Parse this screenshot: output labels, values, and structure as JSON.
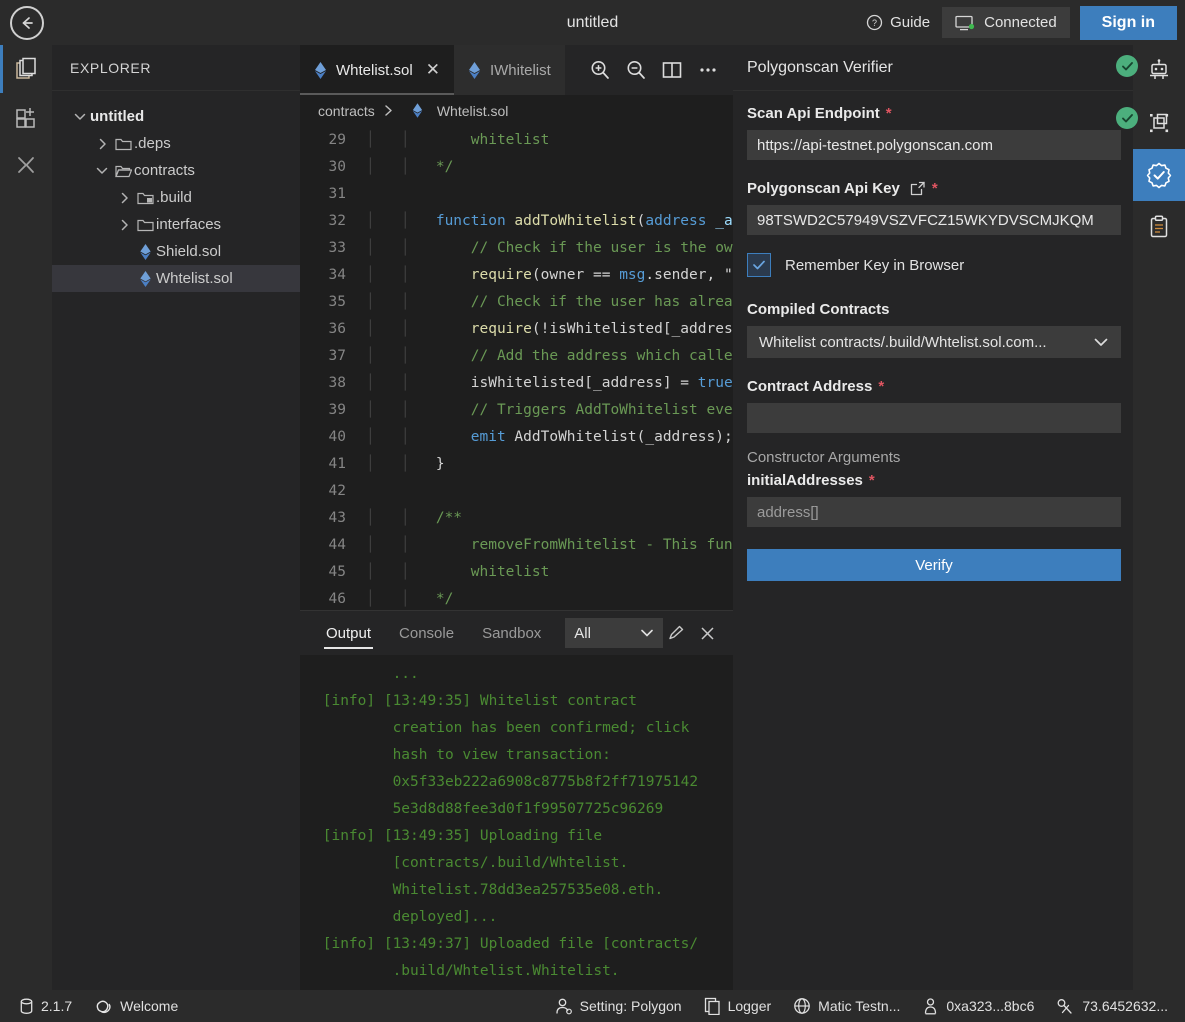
{
  "titlebar": {
    "title": "untitled",
    "guide_label": "Guide",
    "connected_label": "Connected",
    "signin_label": "Sign in"
  },
  "activitybar": {
    "items": [
      {
        "name": "file-explorer-icon",
        "label": "Files"
      },
      {
        "name": "plugin-manager-icon",
        "label": "Plugin Manager"
      },
      {
        "name": "collapse-icon",
        "label": "Collapse"
      }
    ]
  },
  "explorer": {
    "header": "EXPLORER",
    "tree": [
      {
        "label": "untitled",
        "depth": 0,
        "type": "root",
        "expanded": true,
        "selected": false
      },
      {
        "label": ".deps",
        "depth": 1,
        "type": "folder",
        "expanded": false,
        "selected": false
      },
      {
        "label": "contracts",
        "depth": 1,
        "type": "folder",
        "expanded": true,
        "selected": false
      },
      {
        "label": ".build",
        "depth": 2,
        "type": "folder-build",
        "expanded": false,
        "selected": false
      },
      {
        "label": "interfaces",
        "depth": 2,
        "type": "folder",
        "expanded": false,
        "selected": false
      },
      {
        "label": "Shield.sol",
        "depth": 2,
        "type": "sol",
        "expanded": false,
        "selected": false
      },
      {
        "label": "Whtelist.sol",
        "depth": 2,
        "type": "sol",
        "expanded": false,
        "selected": true
      }
    ]
  },
  "editor": {
    "tabs": [
      {
        "label": "Whtelist.sol",
        "active": true,
        "closable": true
      },
      {
        "label": "IWhitelist",
        "active": false,
        "closable": false
      }
    ],
    "tools": [
      {
        "name": "zoom-in-icon"
      },
      {
        "name": "zoom-out-icon"
      },
      {
        "name": "split-editor-icon"
      },
      {
        "name": "more-options-icon"
      }
    ],
    "breadcrumb": {
      "folder": "contracts",
      "file": "Whtelist.sol"
    },
    "lines": [
      {
        "no": "29",
        "indent": 3,
        "tokens": [
          {
            "t": "whitelist",
            "c": "cm"
          }
        ]
      },
      {
        "no": "30",
        "indent": 2,
        "tokens": [
          {
            "t": "*/",
            "c": "cm"
          }
        ]
      },
      {
        "no": "31",
        "indent": 0,
        "tokens": []
      },
      {
        "no": "32",
        "indent": 2,
        "tokens": [
          {
            "t": "function ",
            "c": "kw"
          },
          {
            "t": "addToWhitelist",
            "c": "fn"
          },
          {
            "t": "(",
            "c": "pl"
          },
          {
            "t": "address",
            "c": "kw"
          },
          {
            "t": " _a",
            "c": "var"
          }
        ]
      },
      {
        "no": "33",
        "indent": 3,
        "tokens": [
          {
            "t": "// Check if the user is the ow",
            "c": "cm"
          }
        ]
      },
      {
        "no": "34",
        "indent": 3,
        "tokens": [
          {
            "t": "require",
            "c": "fn"
          },
          {
            "t": "(",
            "c": "pl"
          },
          {
            "t": "owner",
            "c": "pl"
          },
          {
            "t": " == ",
            "c": "pl"
          },
          {
            "t": "msg",
            "c": "kw"
          },
          {
            "t": ".sender, \"",
            "c": "pl"
          }
        ]
      },
      {
        "no": "35",
        "indent": 3,
        "tokens": [
          {
            "t": "// Check if the user has alrea",
            "c": "cm"
          }
        ]
      },
      {
        "no": "36",
        "indent": 3,
        "tokens": [
          {
            "t": "require",
            "c": "fn"
          },
          {
            "t": "(!",
            "c": "pl"
          },
          {
            "t": "isWhitelisted[_addres",
            "c": "pl"
          }
        ]
      },
      {
        "no": "37",
        "indent": 3,
        "tokens": [
          {
            "t": "// Add the address which calle",
            "c": "cm"
          }
        ]
      },
      {
        "no": "38",
        "indent": 3,
        "tokens": [
          {
            "t": "isWhitelisted[_address] = ",
            "c": "pl"
          },
          {
            "t": "true",
            "c": "kw"
          }
        ]
      },
      {
        "no": "39",
        "indent": 3,
        "tokens": [
          {
            "t": "// Triggers AddToWhitelist eve",
            "c": "cm"
          }
        ]
      },
      {
        "no": "40",
        "indent": 3,
        "tokens": [
          {
            "t": "emit ",
            "c": "kw"
          },
          {
            "t": "AddToWhitelist",
            "c": "pl"
          },
          {
            "t": "(_address);",
            "c": "pl"
          }
        ]
      },
      {
        "no": "41",
        "indent": 2,
        "tokens": [
          {
            "t": "}",
            "c": "pl"
          }
        ]
      },
      {
        "no": "42",
        "indent": 0,
        "tokens": []
      },
      {
        "no": "43",
        "indent": 2,
        "tokens": [
          {
            "t": "/**",
            "c": "cm"
          }
        ]
      },
      {
        "no": "44",
        "indent": 3,
        "tokens": [
          {
            "t": "removeFromWhitelist - This fun",
            "c": "cm"
          }
        ]
      },
      {
        "no": "45",
        "indent": 3,
        "tokens": [
          {
            "t": "whitelist",
            "c": "cm"
          }
        ]
      },
      {
        "no": "46",
        "indent": 2,
        "tokens": [
          {
            "t": "*/",
            "c": "cm"
          }
        ]
      }
    ]
  },
  "terminal": {
    "tabs": [
      {
        "label": "Output",
        "active": true
      },
      {
        "label": "Console",
        "active": false
      },
      {
        "label": "Sandbox",
        "active": false
      }
    ],
    "filter_value": "All",
    "icons": [
      {
        "name": "clear-output-icon"
      },
      {
        "name": "close-panel-icon"
      }
    ],
    "lines": [
      "         ...",
      " [info] [13:49:35] Whitelist contract",
      "         creation has been confirmed; click",
      "         hash to view transaction:",
      "         0x5f33eb222a6908c8775b8f2ff71975142",
      "         5e3d8d88fee3d0f1f99507725c96269",
      " [info] [13:49:35] Uploading file",
      "         [contracts/.build/Whtelist.",
      "         Whitelist.78dd3ea257535e08.eth.",
      "         deployed]...",
      " [info] [13:49:37] Uploaded file [contracts/",
      "         .build/Whtelist.Whitelist."
    ]
  },
  "verifier": {
    "header": "Polygonscan Verifier",
    "scan_endpoint": {
      "label": "Scan Api Endpoint",
      "required": "*",
      "value": "https://api-testnet.polygonscan.com"
    },
    "api_key": {
      "label": "Polygonscan Api Key",
      "required": "*",
      "value": "98TSWD2C57949VSZVFCZ15WKYDVSCMJKQM"
    },
    "remember_key": {
      "label": "Remember Key in Browser",
      "checked": true
    },
    "compiled_contracts": {
      "label": "Compiled Contracts",
      "value": "Whitelist contracts/.build/Whtelist.sol.com..."
    },
    "contract_address": {
      "label": "Contract Address",
      "required": "*",
      "value": "",
      "placeholder": ""
    },
    "constructor_args": {
      "label": "Constructor Arguments",
      "arg_label": "initialAddresses",
      "required": "*",
      "placeholder": "address[]",
      "value": ""
    },
    "verify_label": "Verify"
  },
  "rightbar": {
    "items": [
      {
        "name": "remix-ai-robot-icon",
        "active": false,
        "badge": true
      },
      {
        "name": "solidity-compiler-icon",
        "active": false,
        "badge": true
      },
      {
        "name": "contract-verifier-icon",
        "active": true,
        "badge": false
      },
      {
        "name": "clipboard-icon",
        "active": false,
        "badge": false
      }
    ]
  },
  "statusbar": {
    "left": [
      {
        "name": "version-badge",
        "icon": "database-icon",
        "label": "2.1.7"
      },
      {
        "name": "welcome-button",
        "icon": "remix-logo-icon",
        "label": "Welcome"
      }
    ],
    "right": [
      {
        "name": "setting-indicator",
        "icon": "user-icon",
        "label": "Setting: Polygon"
      },
      {
        "name": "logger-button",
        "icon": "copy-icon",
        "label": "Logger"
      },
      {
        "name": "network-indicator",
        "icon": "globe-icon",
        "label": "Matic Testn..."
      },
      {
        "name": "account-indicator",
        "icon": "location-icon",
        "label": "0xa323...8bc6"
      },
      {
        "name": "balance-indicator",
        "icon": "link-icon",
        "label": "73.6452632..."
      }
    ]
  },
  "colors": {
    "accent": "#3d7ebd",
    "success": "#4caf7d",
    "required": "#e05561",
    "editor_bg": "#1e1e1e",
    "panel_bg": "#252526",
    "bar_bg": "#2b2b2b"
  }
}
